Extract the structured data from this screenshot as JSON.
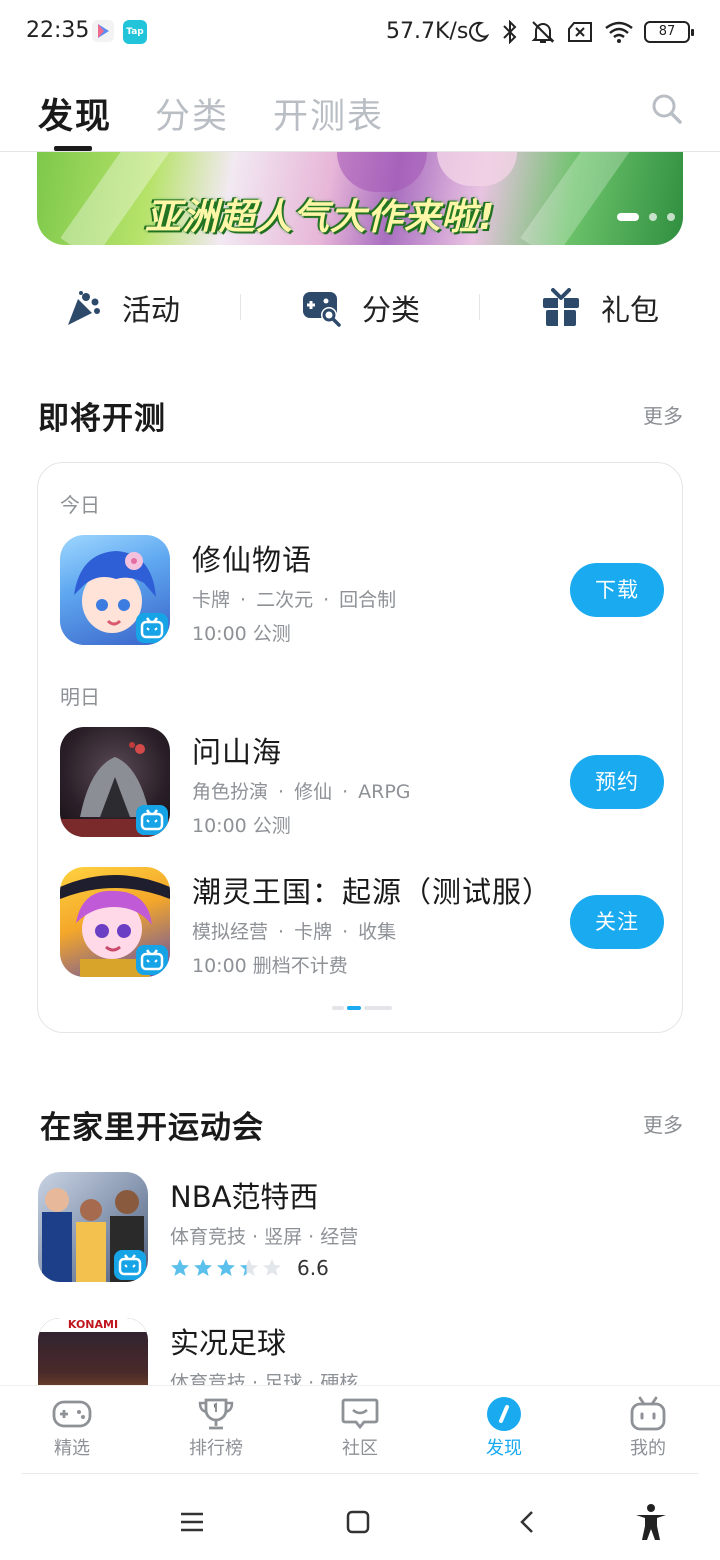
{
  "status_bar": {
    "time": "22:35",
    "speed": "57.7K/s",
    "battery": "87",
    "app_badge": "Tap"
  },
  "top_tabs": [
    {
      "label": "发现",
      "active": true
    },
    {
      "label": "分类",
      "active": false
    },
    {
      "label": "开测表",
      "active": false
    }
  ],
  "banner": {
    "text": "亚洲超人气大作来啦!",
    "slide_index": 1,
    "slide_count": 3
  },
  "quick_entries": [
    {
      "label": "活动",
      "icon": "party-popper-icon"
    },
    {
      "label": "分类",
      "icon": "gamepad-search-icon"
    },
    {
      "label": "礼包",
      "icon": "gift-icon"
    }
  ],
  "upcoming": {
    "title": "即将开测",
    "more": "更多",
    "groups": [
      {
        "day": "今日",
        "games": [
          {
            "name": "修仙物语",
            "tags": [
              "卡牌",
              "二次元",
              "回合制"
            ],
            "time": "10:00 公测",
            "button": "下载"
          }
        ]
      },
      {
        "day": "明日",
        "games": [
          {
            "name": "问山海",
            "tags": [
              "角色扮演",
              "修仙",
              "ARPG"
            ],
            "time": "10:00 公测",
            "button": "预约"
          },
          {
            "name": "潮灵王国：起源（测试服）",
            "tags": [
              "模拟经营",
              "卡牌",
              "收集"
            ],
            "time": "10:00 删档不计费",
            "button": "关注"
          }
        ]
      }
    ]
  },
  "sports": {
    "title": "在家里开运动会",
    "more": "更多",
    "games": [
      {
        "name": "NBA范特西",
        "tags": "体育竞技 · 竖屏 · 经营",
        "rating": "6.6",
        "stars": 3.3
      },
      {
        "name": "实况足球",
        "tags": "体育竞技 · 足球 · 硬核",
        "icon_text": "KONAMI"
      }
    ]
  },
  "bottom_nav": [
    {
      "label": "精选",
      "icon": "gamepad-icon",
      "active": false
    },
    {
      "label": "排行榜",
      "icon": "trophy-icon",
      "active": false
    },
    {
      "label": "社区",
      "icon": "chat-bubble-icon",
      "active": false
    },
    {
      "label": "发现",
      "icon": "compass-icon",
      "active": true
    },
    {
      "label": "我的",
      "icon": "tv-face-icon",
      "active": false
    }
  ],
  "colors": {
    "accent": "#19aaf0",
    "text_primary": "#1a1a1a",
    "text_secondary": "#8e9297"
  }
}
